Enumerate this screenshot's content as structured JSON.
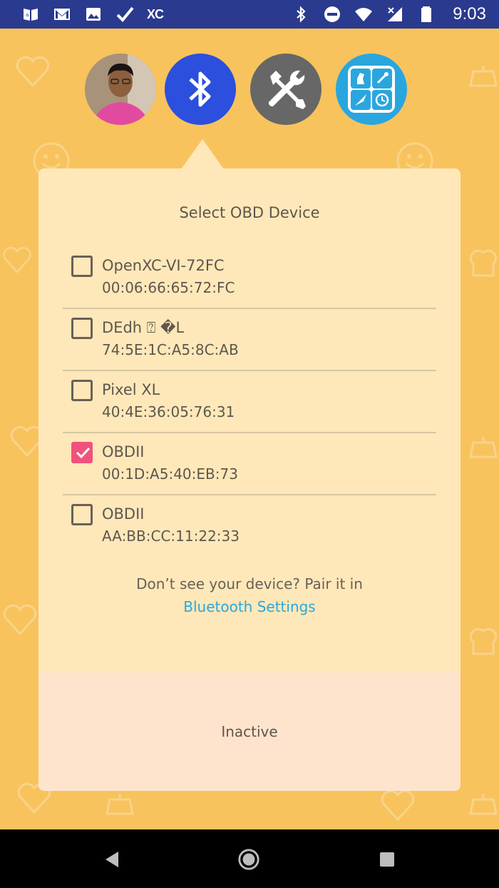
{
  "status_bar": {
    "time": "9:03",
    "left_icons": [
      "amazon-icon",
      "gmail-icon",
      "gallery-icon",
      "check-icon",
      "xc-icon"
    ],
    "xc_label": "XC",
    "right_icons": [
      "bluetooth-icon",
      "do-not-disturb-icon",
      "wifi-icon",
      "cell-signal-icon",
      "battery-icon"
    ]
  },
  "top_buttons": [
    {
      "name": "profile-avatar",
      "color": "#b9a38a"
    },
    {
      "name": "bluetooth",
      "color": "#2c4fdd"
    },
    {
      "name": "tools",
      "color": "#676767"
    },
    {
      "name": "app-grid",
      "color": "#2aa6df"
    }
  ],
  "card": {
    "title": "Select OBD Device",
    "devices": [
      {
        "name": "OpenXC-VI-72FC",
        "mac": "00:06:66:65:72:FC",
        "checked": false
      },
      {
        "name": "DEdh  ⍰ �L",
        "mac": "74:5E:1C:A5:8C:AB",
        "checked": false
      },
      {
        "name": "Pixel XL",
        "mac": "40:4E:36:05:76:31",
        "checked": false
      },
      {
        "name": "OBDII",
        "mac": "00:1D:A5:40:EB:73",
        "checked": true
      },
      {
        "name": "OBDII",
        "mac": "AA:BB:CC:11:22:33",
        "checked": false
      }
    ],
    "hint_text": "Don’t see your device? Pair it in",
    "hint_link": "Bluetooth Settings",
    "footer_status": "Inactive"
  },
  "colors": {
    "background": "#f8c35d",
    "card": "#fee8b9",
    "footer": "#ffe4cd",
    "accent_check": "#f0527d",
    "link": "#2ba7dc",
    "status_bar": "#2a3a8f"
  }
}
